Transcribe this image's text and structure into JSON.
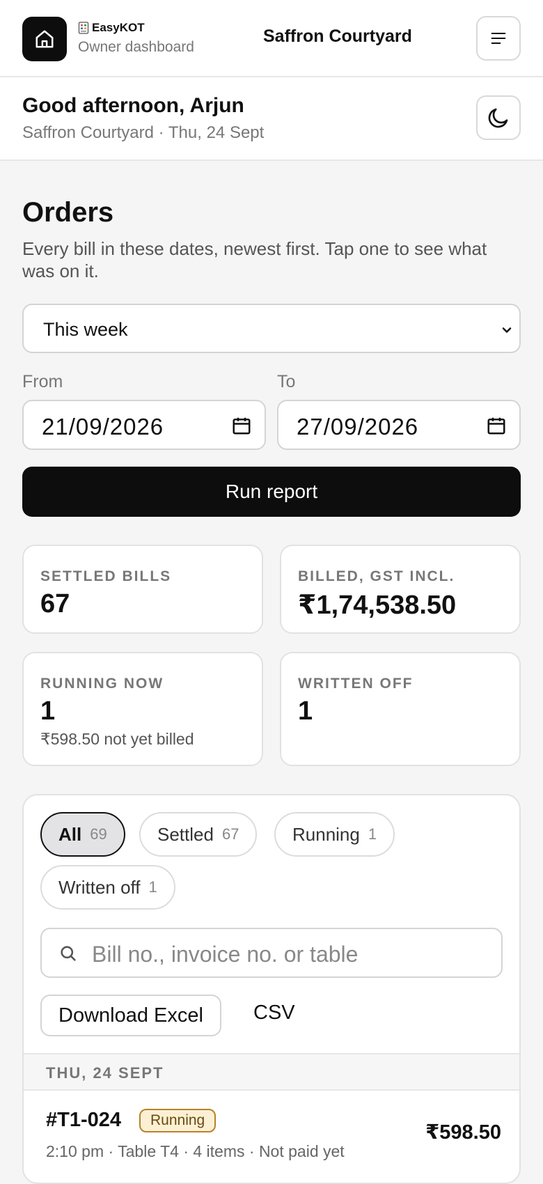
{
  "header": {
    "brand_name": "EasyKOT",
    "brand_sub": "Owner dashboard",
    "venue": "Saffron Courtyard",
    "icons": [
      "home-icon",
      "receipt-icon",
      "menu-icon"
    ]
  },
  "greeting": {
    "title": "Good afternoon, Arjun",
    "subtitle": "Saffron Courtyard · Thu, 24 Sept",
    "theme_icon": "moon-icon"
  },
  "report": {
    "title": "Orders",
    "description": "Every bill in these dates, newest first. Tap one to see what was on it.",
    "range_selected": "This week",
    "from_label": "From",
    "from_value": "21/09/2026",
    "to_label": "To",
    "to_value": "27/09/2026",
    "run_label": "Run report"
  },
  "stats": [
    {
      "label": "SETTLED BILLS",
      "value": "67",
      "note": ""
    },
    {
      "label": "BILLED, GST INCL.",
      "value": "₹1,74,538.50",
      "note": ""
    },
    {
      "label": "RUNNING NOW",
      "value": "1",
      "note": "₹598.50 not yet billed"
    },
    {
      "label": "WRITTEN OFF",
      "value": "1",
      "note": ""
    }
  ],
  "filters": [
    {
      "label": "All",
      "count": "69",
      "active": true
    },
    {
      "label": "Settled",
      "count": "67",
      "active": false
    },
    {
      "label": "Running",
      "count": "1",
      "active": false
    },
    {
      "label": "Written off",
      "count": "1",
      "active": false
    }
  ],
  "search": {
    "placeholder": "Bill no., invoice no. or table"
  },
  "export": {
    "excel_label": "Download Excel",
    "csv_label": "CSV"
  },
  "orders": {
    "day_heading": "THU, 24 SEPT",
    "rows": [
      {
        "bill_no": "#T1-024",
        "status": "Running",
        "meta": "2:10 pm · Table T4 · 4 items · Not paid yet",
        "amount": "₹598.50"
      }
    ]
  },
  "colors": {
    "primary": "#0d0d0d",
    "background": "#f5f5f5",
    "running_badge_bg": "#fbf0d4",
    "running_badge_border": "#b7822a"
  }
}
